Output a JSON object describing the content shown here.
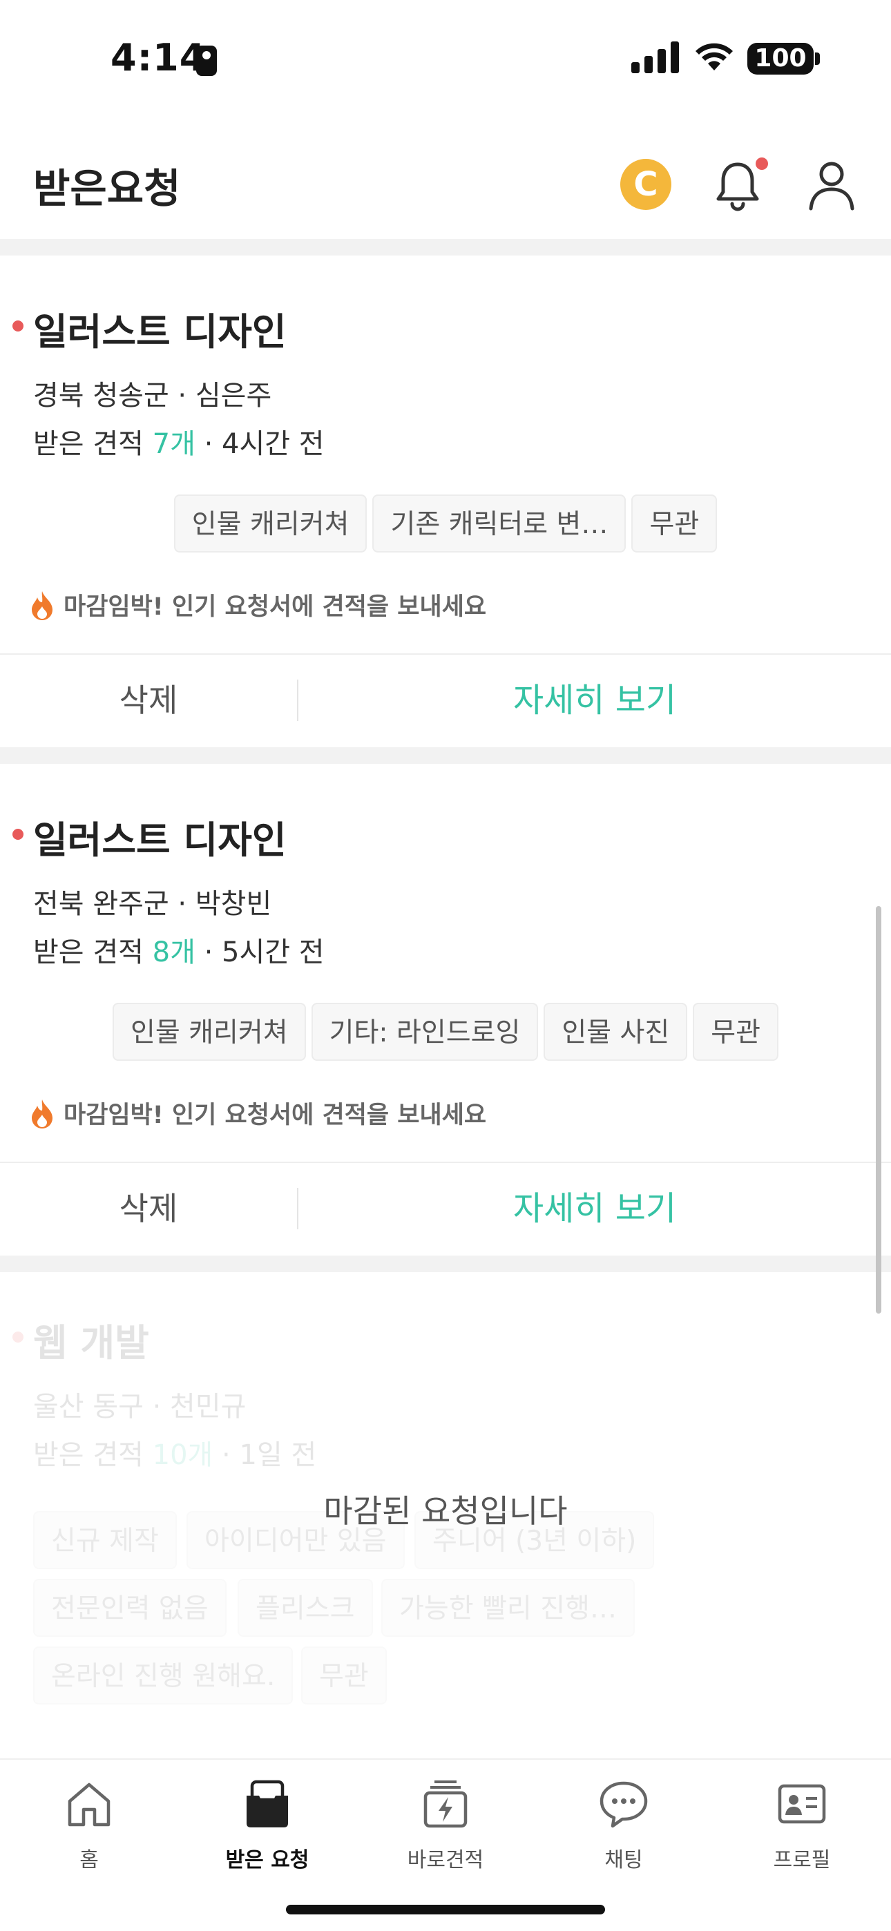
{
  "status_bar": {
    "time": "4:14",
    "battery": "100"
  },
  "header": {
    "title": "받은요청",
    "coin_label": "C"
  },
  "cards": [
    {
      "title": "일러스트 디자인",
      "location": "경북 청송군 · 심은주",
      "quote_prefix": "받은 견적 ",
      "quote_count": "7개",
      "quote_suffix": " · 4시간 전",
      "tags": [
        "인물 캐리커쳐",
        "기존 캐릭터로 변…",
        "무관"
      ],
      "urgent": "마감임박! 인기 요청서에 견적을 보내세요",
      "delete_label": "삭제",
      "detail_label": "자세히 보기"
    },
    {
      "title": "일러스트 디자인",
      "location": "전북 완주군 · 박창빈",
      "quote_prefix": "받은 견적 ",
      "quote_count": "8개",
      "quote_suffix": " · 5시간 전",
      "tags": [
        "인물 캐리커쳐",
        "기타: 라인드로잉",
        "인물 사진",
        "무관"
      ],
      "urgent": "마감임박! 인기 요청서에 견적을 보내세요",
      "delete_label": "삭제",
      "detail_label": "자세히 보기"
    }
  ],
  "closed_card": {
    "title": "웹 개발",
    "location": "울산 동구 · 천민규",
    "quote_prefix": "받은 견적 ",
    "quote_count": "10개",
    "quote_suffix": " · 1일 전",
    "tags": [
      "신규 제작",
      "아이디어만 있음",
      "주니어 (3년 이하)",
      "전문인력 없음",
      "플리스크",
      "가능한 빨리 진행…",
      "온라인 진행 원해요.",
      "무관"
    ],
    "closed_message": "마감된 요청입니다"
  },
  "tabbar": {
    "items": [
      {
        "label": "홈",
        "icon": "home-icon",
        "active": false
      },
      {
        "label": "받은 요청",
        "icon": "inbox-icon",
        "active": true
      },
      {
        "label": "바로견적",
        "icon": "quick-quote-icon",
        "active": false
      },
      {
        "label": "채팅",
        "icon": "chat-icon",
        "active": false
      },
      {
        "label": "프로필",
        "icon": "profile-card-icon",
        "active": false
      }
    ]
  },
  "colors": {
    "accent": "#35c2a3",
    "dot": "#e85a5a",
    "coin": "#f4b73b"
  }
}
